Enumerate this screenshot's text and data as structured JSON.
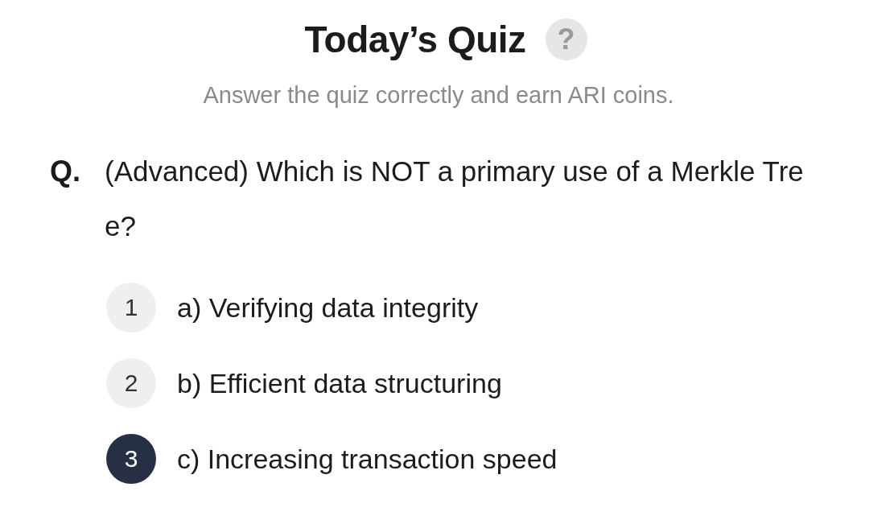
{
  "header": {
    "title": "Today’s Quiz",
    "help_icon": "?",
    "subtitle": "Answer the quiz correctly and earn ARI coins."
  },
  "question": {
    "prefix": "Q.",
    "text": "(Advanced) Which is NOT a primary use of a Merkle Tree?"
  },
  "options": [
    {
      "number": "1",
      "label": "a) Verifying data integrity",
      "selected": false
    },
    {
      "number": "2",
      "label": "b) Efficient data structuring",
      "selected": false
    },
    {
      "number": "3",
      "label": "c) Increasing transaction speed",
      "selected": true
    }
  ]
}
